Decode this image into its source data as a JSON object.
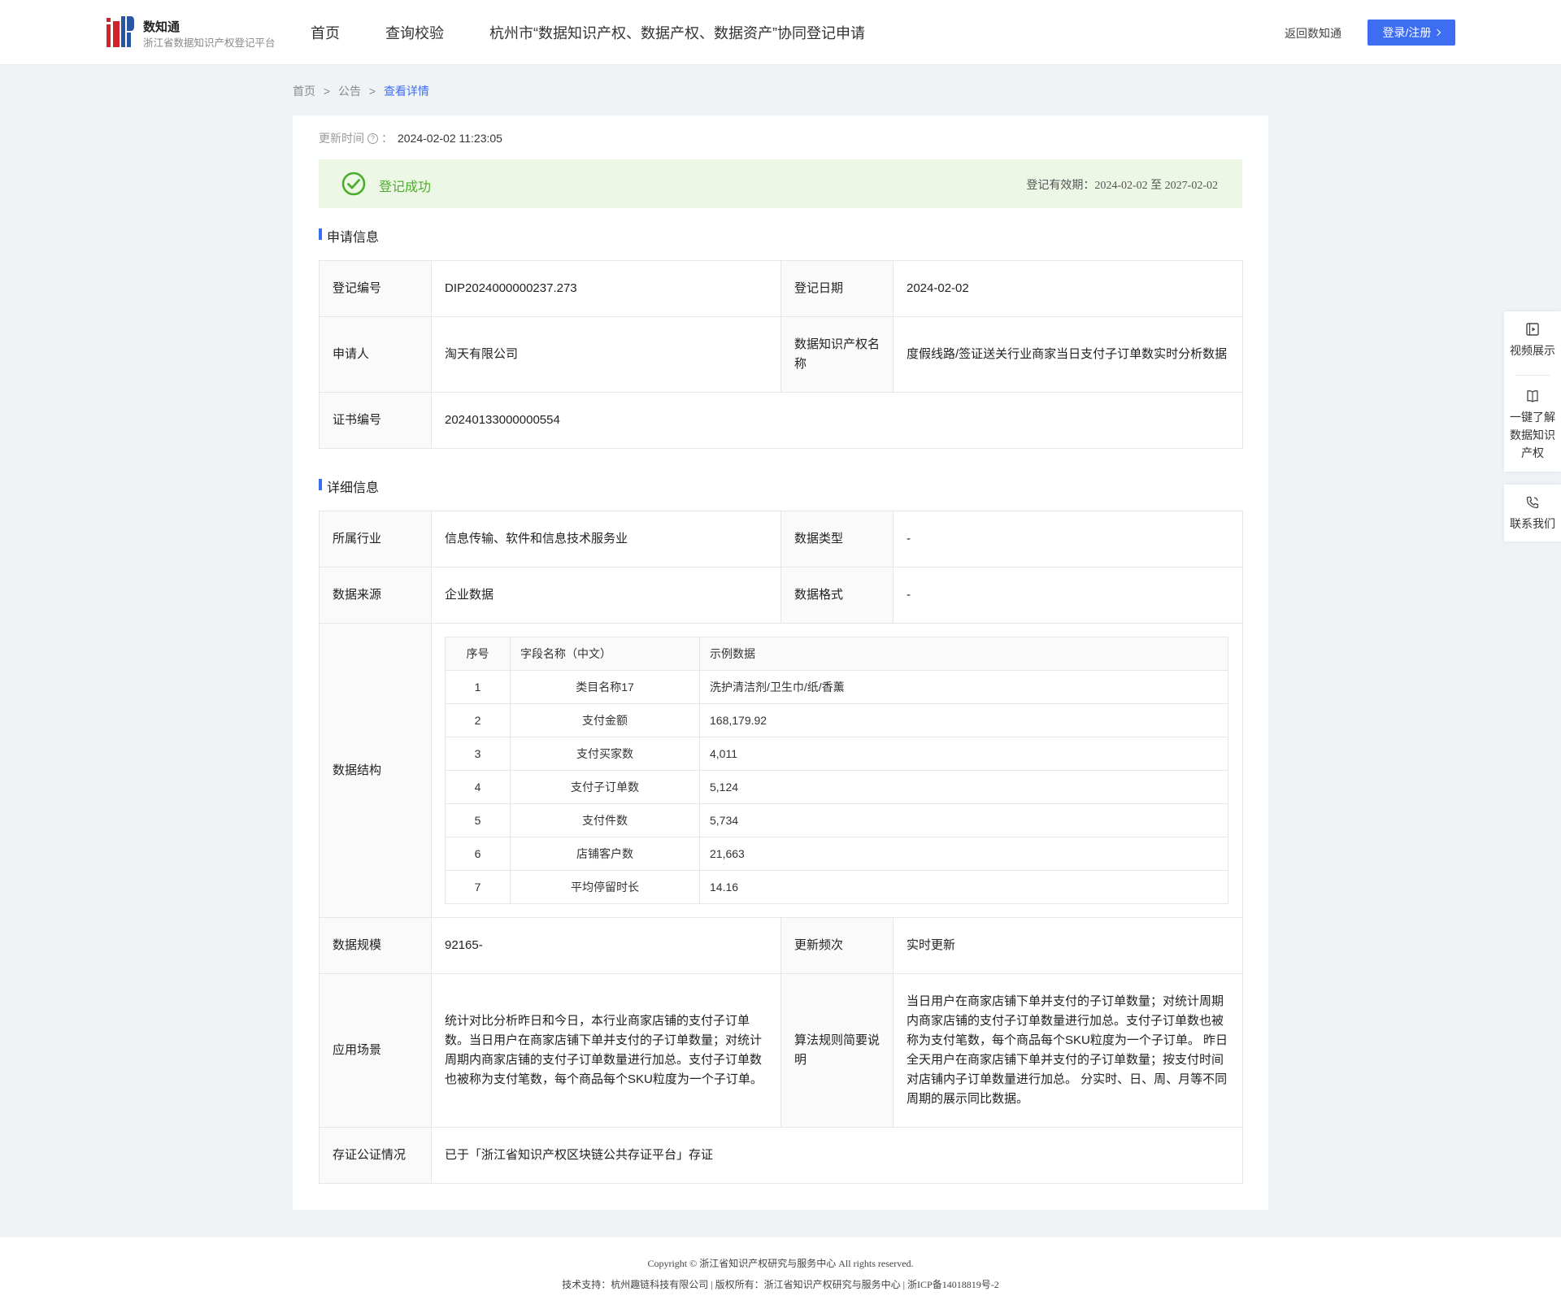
{
  "header": {
    "logo_title": "数知通",
    "logo_subtitle": "浙江省数据知识产权登记平台",
    "nav": [
      "首页",
      "查询校验",
      "杭州市“数据知识产权、数据产权、数据资产”协同登记申请"
    ],
    "return_label": "返回数知通",
    "login_label": "登录/注册"
  },
  "breadcrumb": {
    "home": "首页",
    "sep": ">",
    "notice": "公告",
    "current": "查看详情"
  },
  "update": {
    "label": "更新时间",
    "colon": "：",
    "value": "2024-02-02 11:23:05"
  },
  "status": {
    "text": "登记成功",
    "validity": "登记有效期：2024-02-02 至 2027-02-02",
    "color": "#4cad2c"
  },
  "apply_section": {
    "title": "申请信息",
    "reg_no_label": "登记编号",
    "reg_no": "DIP2024000000237.273",
    "reg_date_label": "登记日期",
    "reg_date": "2024-02-02",
    "applicant_label": "申请人",
    "applicant": "淘天有限公司",
    "ip_name_label": "数据知识产权名称",
    "ip_name": "度假线路/签证送关行业商家当日支付子订单数实时分析数据",
    "cert_no_label": "证书编号",
    "cert_no": "20240133000000554"
  },
  "detail_section": {
    "title": "详细信息",
    "industry_label": "所属行业",
    "industry": "信息传输、软件和信息技术服务业",
    "data_type_label": "数据类型",
    "data_type": "-",
    "source_label": "数据来源",
    "source": "企业数据",
    "format_label": "数据格式",
    "format": "-",
    "structure_label": "数据结构",
    "structure_headers": [
      "序号",
      "字段名称（中文）",
      "示例数据"
    ],
    "structure_rows": [
      [
        "1",
        "类目名称17",
        "洗护清洁剂/卫生巾/纸/香薰"
      ],
      [
        "2",
        "支付金额",
        "168,179.92"
      ],
      [
        "3",
        "支付买家数",
        "4,011"
      ],
      [
        "4",
        "支付子订单数",
        "5,124"
      ],
      [
        "5",
        "支付件数",
        "5,734"
      ],
      [
        "6",
        "店铺客户数",
        "21,663"
      ],
      [
        "7",
        "平均停留时长",
        "14.16"
      ]
    ],
    "scale_label": "数据规模",
    "scale": "92165-",
    "frequency_label": "更新频次",
    "frequency": "实时更新",
    "scenario_label": "应用场景",
    "scenario": "统计对比分析昨日和今日，本行业商家店铺的支付子订单数。当日用户在商家店铺下单并支付的子订单数量；对统计周期内商家店铺的支付子订单数量进行加总。支付子订单数也被称为支付笔数，每个商品每个SKU粒度为一个子订单。",
    "algorithm_label": "算法规则简要说明",
    "algorithm": "当日用户在商家店铺下单并支付的子订单数量；对统计周期内商家店铺的支付子订单数量进行加总。支付子订单数也被称为支付笔数，每个商品每个SKU粒度为一个子订单。 昨日全天用户在商家店铺下单并支付的子订单数量；按支付时间对店铺内子订单数量进行加总。 分实时、日、周、月等不同周期的展示同比数据。",
    "notary_label": "存证公证情况",
    "notary": "已于「浙江省知识产权区块链公共存证平台」存证"
  },
  "side": {
    "video": "视频展示",
    "learn": [
      "一键了解",
      "数据知识",
      "产权"
    ],
    "contact": "联系我们"
  },
  "footer": {
    "copyright": "Copyright © 浙江省知识产权研究与服务中心 All rights reserved.",
    "support": "技术支持：杭州趣链科技有限公司 | 版权所有：浙江省知识产权研究与服务中心 | 浙ICP备14018819号-2"
  },
  "colors": {
    "accent": "#3d6ef2",
    "success_bg": "#edf7e6",
    "page_bg": "#eff3f6"
  }
}
